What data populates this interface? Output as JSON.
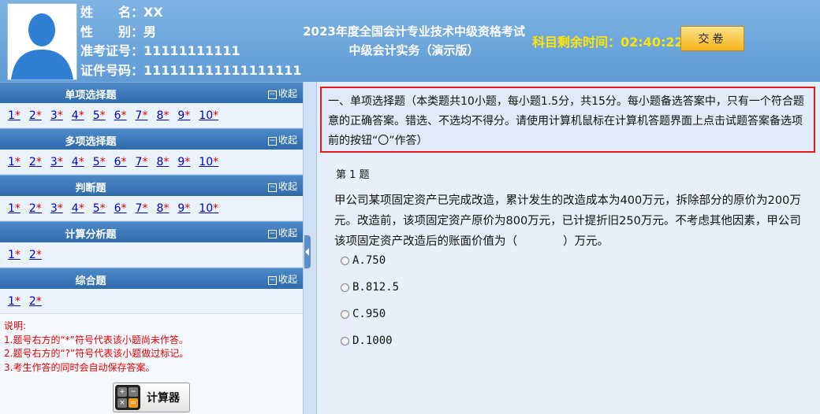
{
  "candidate": {
    "name_label": "姓　　名：",
    "name": "XX",
    "gender_label": "性　　别：",
    "gender": "男",
    "ticket_label": "准考证号：",
    "ticket": "11111111111",
    "id_label": "证件号码：",
    "id": "111111111111111111"
  },
  "exam": {
    "title_line1": "2023年度全国会计专业技术中级资格考试",
    "title_line2": "中级会计实务（演示版）"
  },
  "timer": {
    "label": "科目剩余时间：",
    "value": "02:40:22"
  },
  "submit_label": "交卷",
  "collapse_label": "收起",
  "sections": [
    {
      "title": "单项选择题",
      "questions": [
        "1",
        "2",
        "3",
        "4",
        "5",
        "6",
        "7",
        "8",
        "9",
        "10"
      ]
    },
    {
      "title": "多项选择题",
      "questions": [
        "1",
        "2",
        "3",
        "4",
        "5",
        "6",
        "7",
        "8",
        "9",
        "10"
      ]
    },
    {
      "title": "判断题",
      "questions": [
        "1",
        "2",
        "3",
        "4",
        "5",
        "6",
        "7",
        "8",
        "9",
        "10"
      ]
    },
    {
      "title": "计算分析题",
      "questions": [
        "1",
        "2"
      ]
    },
    {
      "title": "综合题",
      "questions": [
        "1",
        "2"
      ]
    }
  ],
  "unanswered_mark": "*",
  "notes": [
    "说明:",
    "1.题号右方的“*”符号代表该小题尚未作答。",
    "2.题号右方的“?”符号代表该小题做过标记。",
    "3.考生作答的同时会自动保存答案。"
  ],
  "calculator_label": "计算器",
  "instructions": "一、单项选择题（本类题共10小题，每小题1.5分，共15分。每小题备选答案中，只有一个符合题意的正确答案。错选、不选均不得分。请使用计算机鼠标在计算机答题界面上点击试题答案备选项前的按钮“〇”作答）",
  "question": {
    "label": "第 1 题",
    "stem": "甲公司某项固定资产已完成改造，累计发生的改造成本为400万元，拆除部分的原价为200万元。改造前，该项固定资产原价为800万元，已计提折旧250万元。不考虑其他因素，甲公司该项固定资产改造后的账面价值为（　　　　）万元。",
    "options": [
      {
        "label": "A.",
        "value": "750"
      },
      {
        "label": "B.",
        "value": "812.5"
      },
      {
        "label": "C.",
        "value": "950"
      },
      {
        "label": "D.",
        "value": "1000"
      }
    ]
  }
}
